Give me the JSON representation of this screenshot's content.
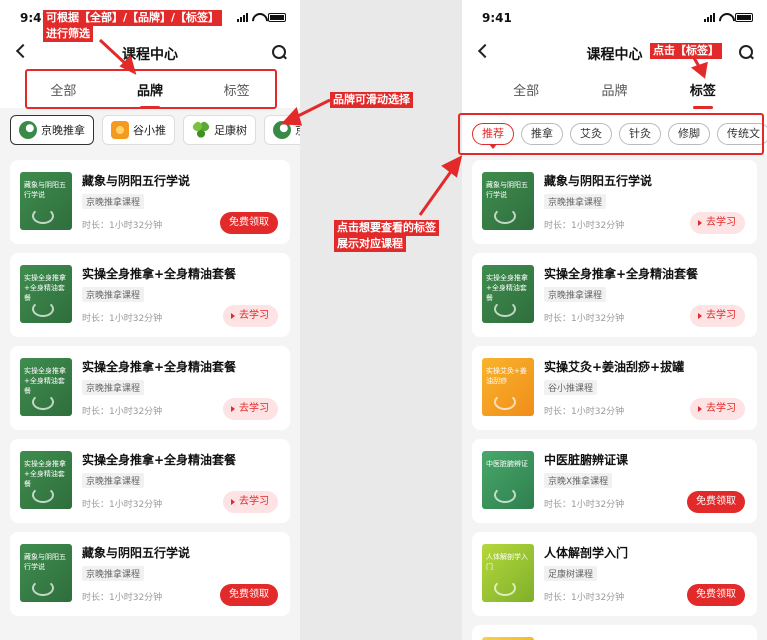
{
  "left": {
    "status_time": "9:41",
    "title": "课程中心",
    "tabs": [
      {
        "label": "全部"
      },
      {
        "label": "品牌"
      },
      {
        "label": "标签"
      }
    ],
    "active_tab": "品牌",
    "brands": [
      {
        "label": "京晚推拿",
        "icon": "leaf-logo",
        "active": true
      },
      {
        "label": "谷小推",
        "icon": "orange-logo"
      },
      {
        "label": "足康树",
        "icon": "clover-logo"
      },
      {
        "label": "京",
        "icon": "leaf-logo"
      }
    ],
    "cards": [
      {
        "title": "藏象与阴阳五行学说",
        "thumb_text": "藏象与阴阳五行学说",
        "brand": "京晚推拿课程",
        "duration": "时长：1小时32分钟",
        "action": "免费领取",
        "action_type": "free"
      },
      {
        "title": "实操全身推拿+全身精油套餐",
        "thumb_text": "实操全身推拿+全身精油套餐",
        "brand": "京晚推拿课程",
        "duration": "时长：1小时32分钟",
        "action": "去学习",
        "action_type": "study"
      },
      {
        "title": "实操全身推拿+全身精油套餐",
        "thumb_text": "实操全身推拿+全身精油套餐",
        "brand": "京晚推拿课程",
        "duration": "时长：1小时32分钟",
        "action": "去学习",
        "action_type": "study"
      },
      {
        "title": "实操全身推拿+全身精油套餐",
        "thumb_text": "实操全身推拿+全身精油套餐",
        "brand": "京晚推拿课程",
        "duration": "时长：1小时32分钟",
        "action": "去学习",
        "action_type": "study"
      },
      {
        "title": "藏象与阴阳五行学说",
        "thumb_text": "藏象与阴阳五行学说",
        "brand": "京晚推拿课程",
        "duration": "时长：1小时32分钟",
        "action": "免费领取",
        "action_type": "free"
      }
    ]
  },
  "right": {
    "status_time": "9:41",
    "title": "课程中心",
    "tabs": [
      {
        "label": "全部"
      },
      {
        "label": "品牌"
      },
      {
        "label": "标签"
      }
    ],
    "active_tab": "标签",
    "tags": [
      {
        "label": "推荐",
        "active": true
      },
      {
        "label": "推拿"
      },
      {
        "label": "艾灸"
      },
      {
        "label": "针灸"
      },
      {
        "label": "修脚"
      },
      {
        "label": "传统文"
      }
    ],
    "cards": [
      {
        "title": "藏象与阴阳五行学说",
        "thumb_text": "藏象与阴阳五行学说",
        "brand": "京晚推拿课程",
        "duration": "时长：1小时32分钟",
        "action": "去学习",
        "action_type": "study",
        "thumb": "green"
      },
      {
        "title": "实操全身推拿+全身精油套餐",
        "thumb_text": "实操全身推拿+全身精油套餐",
        "brand": "京晚推拿课程",
        "duration": "时长：1小时32分钟",
        "action": "去学习",
        "action_type": "study",
        "thumb": "green"
      },
      {
        "title": "实操艾灸+姜油刮痧+拔罐",
        "thumb_text": "实操艾灸+姜油刮痧",
        "brand": "谷小推课程",
        "duration": "时长：1小时32分钟",
        "action": "去学习",
        "action_type": "study",
        "thumb": "orange"
      },
      {
        "title": "中医脏腑辨证课",
        "thumb_text": "中医脏腑辨证",
        "brand": "京晚X推拿课程",
        "duration": "时长：1小时32分钟",
        "action": "免费领取",
        "action_type": "free",
        "thumb": "green2"
      },
      {
        "title": "人体解剖学入门",
        "thumb_text": "人体解剖学入门",
        "brand": "足康树课程",
        "duration": "时长：1小时32分钟",
        "action": "免费领取",
        "action_type": "free",
        "thumb": "lime"
      }
    ]
  },
  "annotations": {
    "filter_note_line1": "可根据【全部】/【品牌】/【标签】",
    "filter_note_line2": "进行筛选",
    "brand_scroll_note": "品牌可滑动选择",
    "tag_click_note": "点击【标签】",
    "tag_view_note_line1": "点击想要查看的标签",
    "tag_view_note_line2": "展示对应课程"
  },
  "colors": {
    "accent": "#e32a2a",
    "card_bg": "#ffffff",
    "page_bg": "#f4f4f4"
  }
}
